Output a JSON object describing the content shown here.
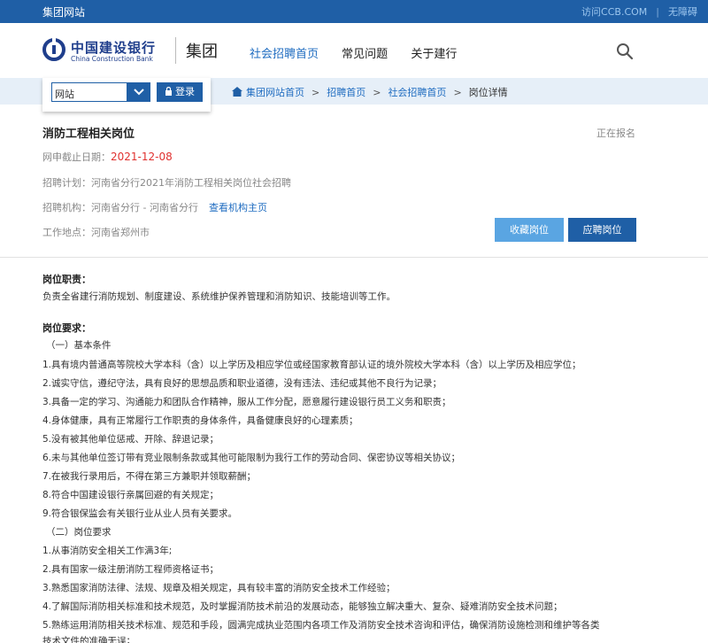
{
  "topbar": {
    "site_name": "集团网站",
    "link_ccb": "访问CCB.COM",
    "separator": "|",
    "link_accessible": "无障碍"
  },
  "header": {
    "logo_cn": "中国建设银行",
    "logo_en": "China Construction Bank",
    "logo_group": "集团",
    "nav": [
      "社会招聘首页",
      "常见问题",
      "关于建行"
    ],
    "search_icon": "search-icon"
  },
  "site_select": {
    "value": "网站",
    "login_label": "登录",
    "login_icon": "lock-icon"
  },
  "breadcrumb": {
    "items": [
      "集团网站首页",
      "招聘首页",
      "社会招聘首页",
      "岗位详情"
    ],
    "sep": ">"
  },
  "job": {
    "title": "消防工程相关岗位",
    "status": "正在报名",
    "deadline_label": "网申截止日期：",
    "deadline": "2021-12-08",
    "plan_label": "招聘计划：",
    "plan": "河南省分行2021年消防工程相关岗位社会招聘",
    "org_label": "招聘机构：",
    "org": "河南省分行 - 河南省分行",
    "org_link": "查看机构主页",
    "location_label": "工作地点：",
    "location": "河南省郑州市",
    "fav_button": "收藏岗位",
    "apply_button": "应聘岗位"
  },
  "duty": {
    "heading": "岗位职责：",
    "text": "负责全省建行消防规划、制度建设、系统维护保养管理和消防知识、技能培训等工作。"
  },
  "requirements": {
    "heading": "岗位要求：",
    "basic_heading": "（一）基本条件",
    "basic": [
      "1.具有境内普通高等院校大学本科（含）以上学历及相应学位或经国家教育部认证的境外院校大学本科（含）以上学历及相应学位；",
      "2.诚实守信，遵纪守法，具有良好的思想品质和职业道德，没有违法、违纪或其他不良行为记录；",
      "3.具备一定的学习、沟通能力和团队合作精神，服从工作分配，愿意履行建设银行员工义务和职责；",
      "4.身体健康，具有正常履行工作职责的身体条件，具备健康良好的心理素质；",
      "5.没有被其他单位惩戒、开除、辞退记录；",
      "6.未与其他单位签订带有竞业限制条款或其他可能限制为我行工作的劳动合同、保密协议等相关协议；",
      "7.在被我行录用后，不得在第三方兼职并领取薪酬；",
      "8.符合中国建设银行亲属回避的有关规定；",
      "9.符合银保监会有关银行业从业人员有关要求。"
    ],
    "post_heading": "（二）岗位要求",
    "post": [
      "1.从事消防安全相关工作满3年;",
      "2.具有国家一级注册消防工程师资格证书；",
      "3.熟悉国家消防法律、法规、规章及相关规定，具有较丰富的消防安全技术工作经验；",
      "4.了解国际消防相关标准和技术规范，及时掌握消防技术前沿的发展动态，能够独立解决重大、复杂、疑难消防安全技术问题；",
      "5.熟练运用消防相关技术标准、规范和手段，圆满完成执业范围内各项工作及消防安全技术咨询和评估，确保消防设施检测和维护等各类",
      "技术文件的准确无误；"
    ]
  }
}
